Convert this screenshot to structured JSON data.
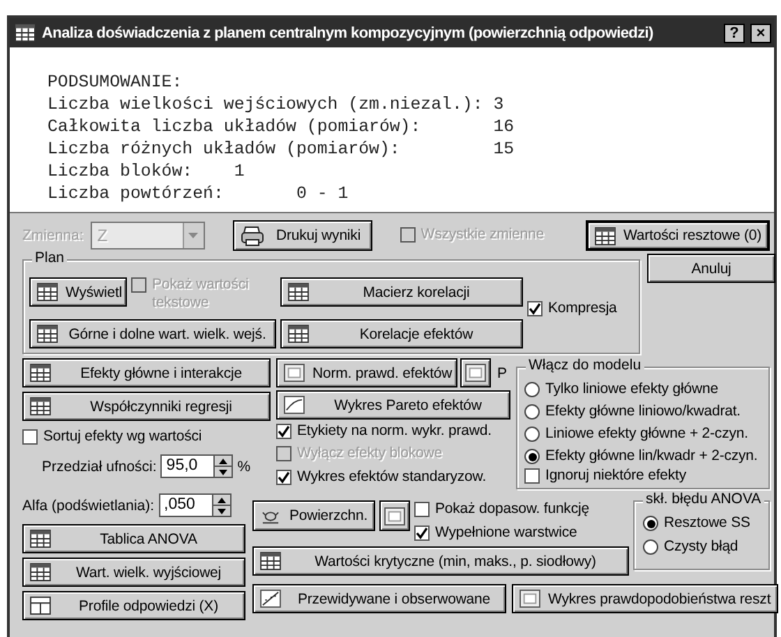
{
  "window": {
    "title": "Analiza doświadczenia z planem centralnym kompozycyjnym (powierzchnią odpowiedzi)",
    "help_button": "?",
    "close_button": "×"
  },
  "output": {
    "lines": [
      "PODSUMOWANIE:",
      "Liczba wielkości wejściowych (zm.niezal.): 3",
      "Całkowita liczba układów (pomiarów):       16",
      "Liczba różnych układów (pomiarów):         15",
      "Liczba bloków:    1",
      "Liczba powtórzeń:       0 - 1"
    ]
  },
  "top_bar": {
    "variable": {
      "label": "Zmienna:",
      "value": "Z",
      "disabled": true
    },
    "print_button": {
      "label": "Drukuj wyniki",
      "kind": "printer"
    },
    "all_variables": {
      "label": "Wszystkie zmienne",
      "checked": false,
      "disabled": true
    },
    "residuals_button": {
      "label": "Wartości resztowe (0)",
      "kind": "table",
      "default": true
    }
  },
  "cancel_button": {
    "label": "Anuluj"
  },
  "plan": {
    "title": "Plan",
    "display_button": {
      "label": "Wyświetl",
      "kind": "table"
    },
    "show_text_values": {
      "label": "Pokaż wartości tekstowe",
      "checked": false,
      "disabled": true
    },
    "correlation_matrix_button": {
      "label": "Macierz korelacji",
      "kind": "table"
    },
    "compression": {
      "label": "Kompresja",
      "checked": true,
      "disabled": false
    },
    "bounds_button": {
      "label": "Górne i dolne wart. wielk. wejś.",
      "kind": "table"
    },
    "effect_correlations_button": {
      "label": "Korelacje efektów",
      "kind": "table"
    }
  },
  "effects_button": {
    "label": "Efekty główne i interakcje",
    "kind": "table"
  },
  "coefficients_button": {
    "label": "Współczynniki regresji",
    "kind": "table"
  },
  "sort_effects": {
    "label": "Sortuj efekty wg wartości",
    "checked": false,
    "disabled": false
  },
  "confidence": {
    "label": "Przedział ufności:",
    "value": "95,0",
    "unit": "%"
  },
  "alpha": {
    "label": "Alfa (podświetlania):",
    "value": ",050"
  },
  "normal_plot_button": {
    "label": "Norm. prawd. efektów",
    "kind": "blank"
  },
  "normal_plot_icon_button": {
    "kind": "blank"
  },
  "p_button": {
    "label": "P"
  },
  "pareto_button": {
    "label": "Wykres Pareto efektów",
    "kind": "pareto"
  },
  "plot_options": [
    {
      "label": "Etykiety na norm. wykr. prawd.",
      "checked": true,
      "disabled": false
    },
    {
      "label": "Wyłącz efekty blokowe",
      "checked": false,
      "disabled": true
    },
    {
      "label": "Wykres efektów standaryzow.",
      "checked": true,
      "disabled": false
    }
  ],
  "model": {
    "title": "Włącz do modelu",
    "options": [
      {
        "label": "Tylko liniowe efekty główne",
        "selected": false
      },
      {
        "label": "Efekty główne liniowo/kwadrat.",
        "selected": false
      },
      {
        "label": "Liniowe efekty główne + 2-czyn.",
        "selected": false
      },
      {
        "label": "Efekty główne lin/kwadr + 2-czyn.",
        "selected": true
      }
    ],
    "ignore_some": {
      "label": "Ignoruj niektóre efekty",
      "checked": false,
      "disabled": false
    }
  },
  "anova_button": {
    "label": "Tablica ANOVA",
    "kind": "table"
  },
  "output_values_button": {
    "label": "Wart. wielk. wyjściowej",
    "kind": "table"
  },
  "profiles_button": {
    "label": "Profile odpowiedzi (X)",
    "kind": "profile"
  },
  "surface_button": {
    "label": "Powierzchn.",
    "kind": "surface"
  },
  "surface_icon_button": {
    "kind": "blank"
  },
  "surface_options": [
    {
      "label": "Pokaż dopasow. funkcję",
      "checked": false,
      "disabled": false
    },
    {
      "label": "Wypełnione warstwice",
      "checked": true,
      "disabled": false
    }
  ],
  "error_term": {
    "title": "skł. błędu ANOVA",
    "options": [
      {
        "label": "Resztowe SS",
        "selected": true
      },
      {
        "label": "Czysty błąd",
        "selected": false
      }
    ]
  },
  "critical_values_button": {
    "label": "Wartości krytyczne (min, maks., p. siodłowy)",
    "kind": "table"
  },
  "predicted_button": {
    "label": "Przewidywane i obserwowane",
    "kind": "scatter"
  },
  "residual_prob_button": {
    "label": "Wykres prawdopodobieństwa reszt",
    "kind": "blank"
  }
}
